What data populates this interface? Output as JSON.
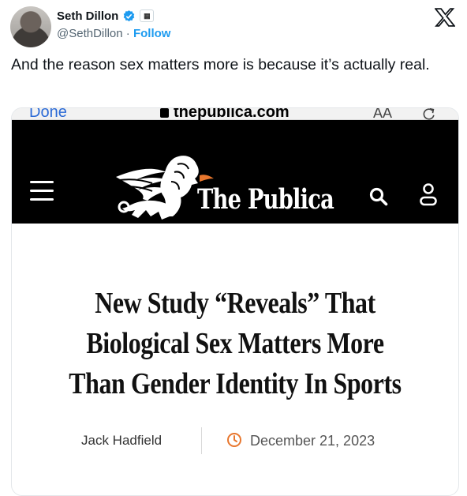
{
  "tweet": {
    "author_name": "Seth Dillon",
    "handle": "@SethDillon",
    "separator": "·",
    "follow_label": "Follow",
    "text": "And the reason sex matters more is because it’s actually real."
  },
  "icons": {
    "verified": "verified-badge-icon",
    "affiliation": "affiliate-badge-icon",
    "platform": "x-logo-icon",
    "lock": "lock-icon",
    "reload": "reload-icon",
    "menu": "hamburger-menu-icon",
    "search": "search-icon",
    "account": "user-icon",
    "date": "clock-icon"
  },
  "screenshot": {
    "browser": {
      "done_label": "Done",
      "url": "thepublica.com",
      "reader_label": "AA"
    },
    "site": {
      "name": "The Publica"
    },
    "article": {
      "headline": "New Study “Reveals” That Biological Sex Matters More Than Gender Identity In Sports",
      "author": "Jack Hadfield",
      "date": "December 21, 2023"
    }
  },
  "colors": {
    "link_blue": "#1d9bf0",
    "verified_blue": "#1d9bf0",
    "accent_orange": "#e8772e",
    "masthead_black": "#000000"
  }
}
